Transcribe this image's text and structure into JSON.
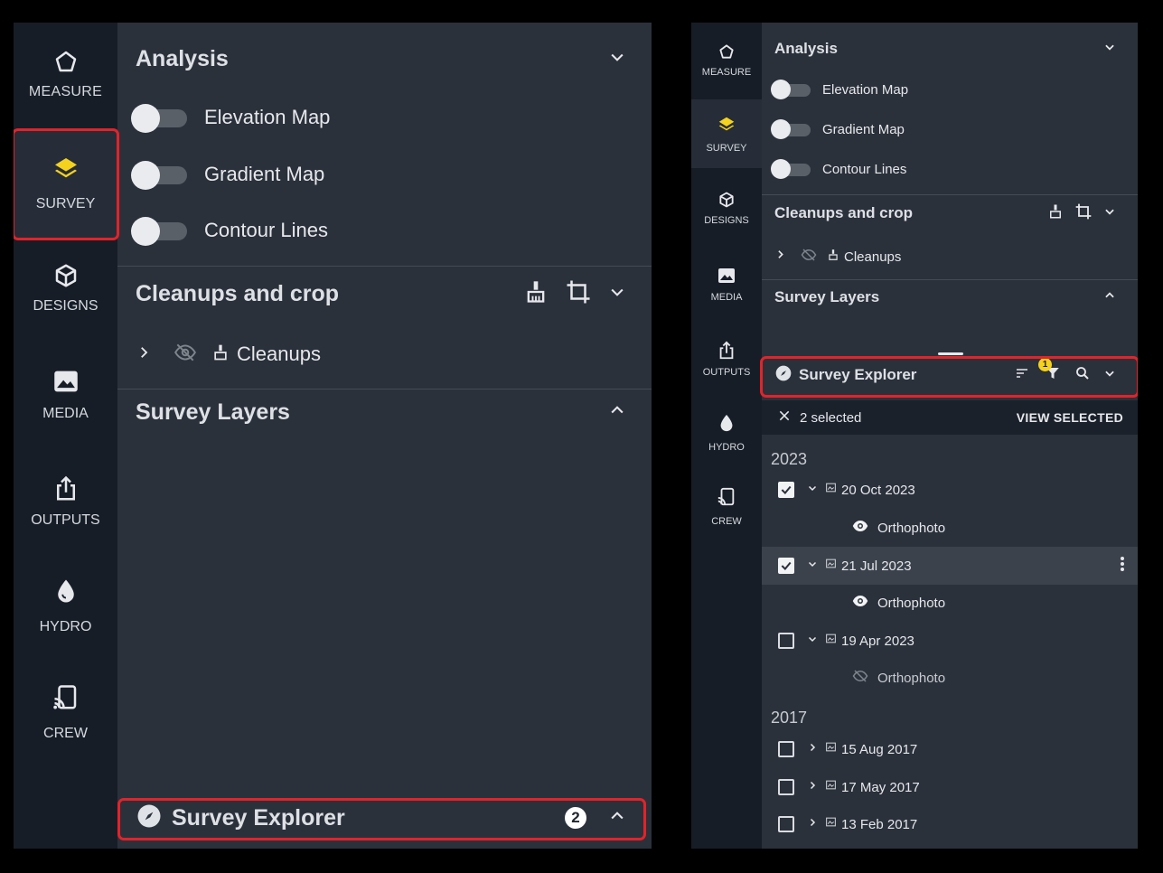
{
  "rail": [
    {
      "label": "MEASURE",
      "icon": "measure-icon"
    },
    {
      "label": "SURVEY",
      "icon": "layers-icon"
    },
    {
      "label": "DESIGNS",
      "icon": "cube-icon"
    },
    {
      "label": "MEDIA",
      "icon": "image-icon"
    },
    {
      "label": "OUTPUTS",
      "icon": "share-icon"
    },
    {
      "label": "HYDRO",
      "icon": "water-drop-icon"
    },
    {
      "label": "CREW",
      "icon": "cast-icon"
    }
  ],
  "analysis": {
    "title": "Analysis",
    "toggles": [
      {
        "label": "Elevation Map",
        "on": false
      },
      {
        "label": "Gradient Map",
        "on": false
      },
      {
        "label": "Contour Lines",
        "on": false
      }
    ]
  },
  "cleanups": {
    "title": "Cleanups and crop",
    "item": "Cleanups"
  },
  "survey_layers": {
    "title": "Survey Layers"
  },
  "explorer": {
    "title": "Survey Explorer",
    "badge_left": "2",
    "filter_badge": "1",
    "selected_text": "2 selected",
    "view_selected": "VIEW SELECTED",
    "groups": [
      {
        "year": "2023",
        "items": [
          {
            "date": "20 Oct 2023",
            "checked": true,
            "expanded": true,
            "child": "Orthophoto",
            "child_visible": true
          },
          {
            "date": "21 Jul 2023",
            "checked": true,
            "expanded": true,
            "child": "Orthophoto",
            "child_visible": true
          },
          {
            "date": "19 Apr 2023",
            "checked": false,
            "expanded": true,
            "child": "Orthophoto",
            "child_visible": false
          }
        ]
      },
      {
        "year": "2017",
        "items": [
          {
            "date": "15 Aug 2017",
            "checked": false,
            "expanded": false
          },
          {
            "date": "17 May 2017",
            "checked": false,
            "expanded": false
          },
          {
            "date": "13 Feb 2017",
            "checked": false,
            "expanded": false
          }
        ]
      }
    ]
  },
  "colors": {
    "accent": "#f5d21e",
    "highlight": "#e2232a",
    "rail_bg": "#171d27",
    "panel_bg": "#2b313b"
  }
}
